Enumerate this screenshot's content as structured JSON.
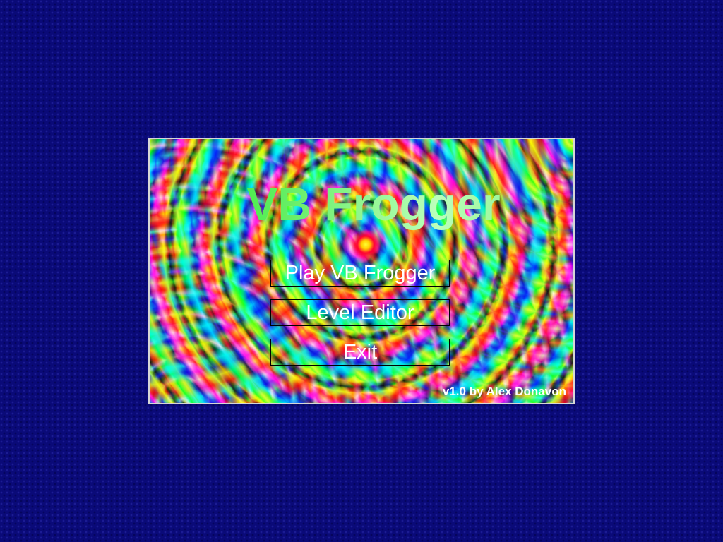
{
  "game": {
    "title": "VB Frogger",
    "credits": "v1.0 by Alex Donavon"
  },
  "menu": {
    "items": [
      {
        "label": "Play VB Frogger"
      },
      {
        "label": "Level Editor"
      },
      {
        "label": "Exit"
      }
    ]
  },
  "colors": {
    "background": "#0a0a78",
    "panel_border": "#d6d6d6",
    "title_green": "#44ee44",
    "menu_text": "#ffffff",
    "menu_border": "#000000",
    "credits_text": "#ffffff"
  }
}
